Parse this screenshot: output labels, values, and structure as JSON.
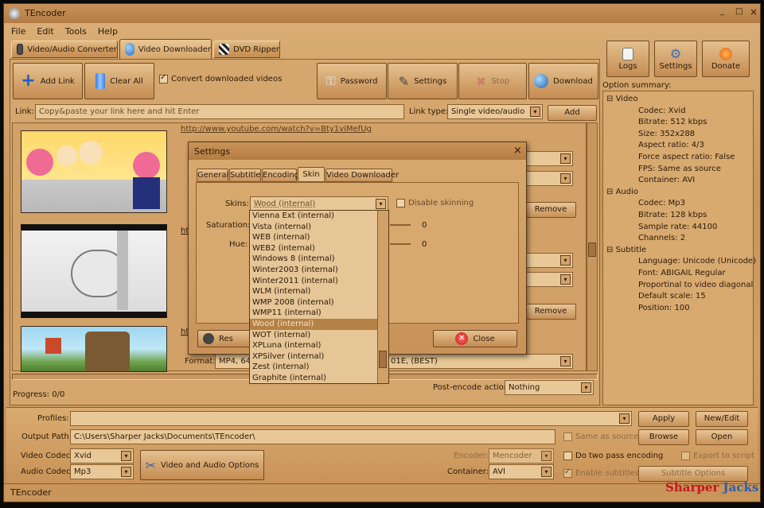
{
  "window": {
    "title": "TEncoder",
    "controls": [
      "_",
      "□",
      "×"
    ]
  },
  "menu": [
    "File",
    "Edit",
    "Tools",
    "Help"
  ],
  "tabs": [
    {
      "label": "Video/Audio Converter",
      "active": false
    },
    {
      "label": "Video Downloader",
      "active": true
    },
    {
      "label": "DVD Ripper",
      "active": false
    }
  ],
  "toolbar": {
    "add_link": "Add Link",
    "clear_all": "Clear All",
    "convert_label": "Convert downloaded videos",
    "convert_checked": true,
    "password": "Password",
    "settings": "Settings",
    "stop": "Stop",
    "download": "Download"
  },
  "right_buttons": {
    "logs": "Logs",
    "settings": "Settings",
    "donate": "Donate"
  },
  "link_bar": {
    "label": "Link:",
    "placeholder": "Copy&paste your link here and hit Enter",
    "type_label": "Link type:",
    "type_value": "Single video/audio",
    "add": "Add"
  },
  "downloads": [
    {
      "url": "http://www.youtube.com/watch?v=Bty1viMefUg",
      "remove": "Remove"
    },
    {
      "url": "ht",
      "remove": "Remove"
    },
    {
      "url": "ht",
      "format_label": "Format:",
      "format_value": "MP4, 64",
      "format_tail": "01E, (BEST)"
    }
  ],
  "progress": {
    "label": "Progress: 0/0",
    "post_label": "Post-encode action:",
    "post_value": "Nothing"
  },
  "option_summary": {
    "title": "Option summary:",
    "groups": [
      {
        "name": "Video",
        "items": [
          "Codec: Xvid",
          "Bitrate: 512 kbps",
          "Size: 352x288",
          "Aspect ratio: 4/3",
          "Force aspect ratio: False",
          "FPS: Same as source",
          "Container: AVI"
        ]
      },
      {
        "name": "Audio",
        "items": [
          "Codec: Mp3",
          "Bitrate: 128 kbps",
          "Sample rate: 44100",
          "Channels: 2"
        ]
      },
      {
        "name": "Subtitle",
        "items": [
          "Language: Unicode (Unicode)",
          "Font: ABIGAIL Regular",
          "Proportinal to video diagonal",
          "Default scale: 15",
          "Position: 100"
        ]
      }
    ]
  },
  "dialog": {
    "title": "Settings",
    "tabs": [
      "General",
      "Subtitle",
      "Encoding",
      "Skin",
      "Video Downloader"
    ],
    "active_tab": "Skin",
    "skins_label": "Skins:",
    "skins_value": "Wood (internal)",
    "disable_label": "Disable skinning",
    "saturation_label": "Saturation:",
    "saturation_value": "0",
    "hue_label": "Hue:",
    "hue_value": "0",
    "reset": "Res",
    "close": "Close",
    "skin_list": [
      "Vienna Ext (internal)",
      "Vista (internal)",
      "WEB (internal)",
      "WEB2 (internal)",
      "Windows 8 (internal)",
      "Winter2003 (internal)",
      "Winter2011 (internal)",
      "WLM (internal)",
      "WMP 2008 (internal)",
      "WMP11 (internal)",
      "Wood (internal)",
      "WOT (internal)",
      "XPLuna (internal)",
      "XPSilver (internal)",
      "Zest (internal)",
      "Graphite (internal)"
    ],
    "selected_skin": "Wood (internal)"
  },
  "bottom": {
    "profiles_label": "Profiles:",
    "apply": "Apply",
    "new_edit": "New/Edit",
    "output_label": "Output Path:",
    "output_value": "C:\\Users\\Sharper Jacks\\Documents\\TEncoder\\",
    "same_as_source": "Same as source",
    "browse": "Browse",
    "open": "Open",
    "video_codec_label": "Video Codec:",
    "video_codec": "Xvid",
    "audio_codec_label": "Audio Codec:",
    "audio_codec": "Mp3",
    "vao_button": "Video and Audio Options",
    "encoder_label": "Encoder:",
    "encoder_value": "Mencoder",
    "two_pass": "Do two pass encoding",
    "export_script": "Export to script",
    "container_label": "Container:",
    "container_value": "AVI",
    "enable_subs": "Enable subtitles",
    "subtitle_options": "Subtitle Options"
  },
  "status": "TEncoder",
  "watermark": {
    "a": "Sharper",
    "b": "Jacks"
  },
  "colors": {
    "wood_light": "#dcb079",
    "wood_dark": "#a06f3b",
    "select": "#b48146"
  }
}
